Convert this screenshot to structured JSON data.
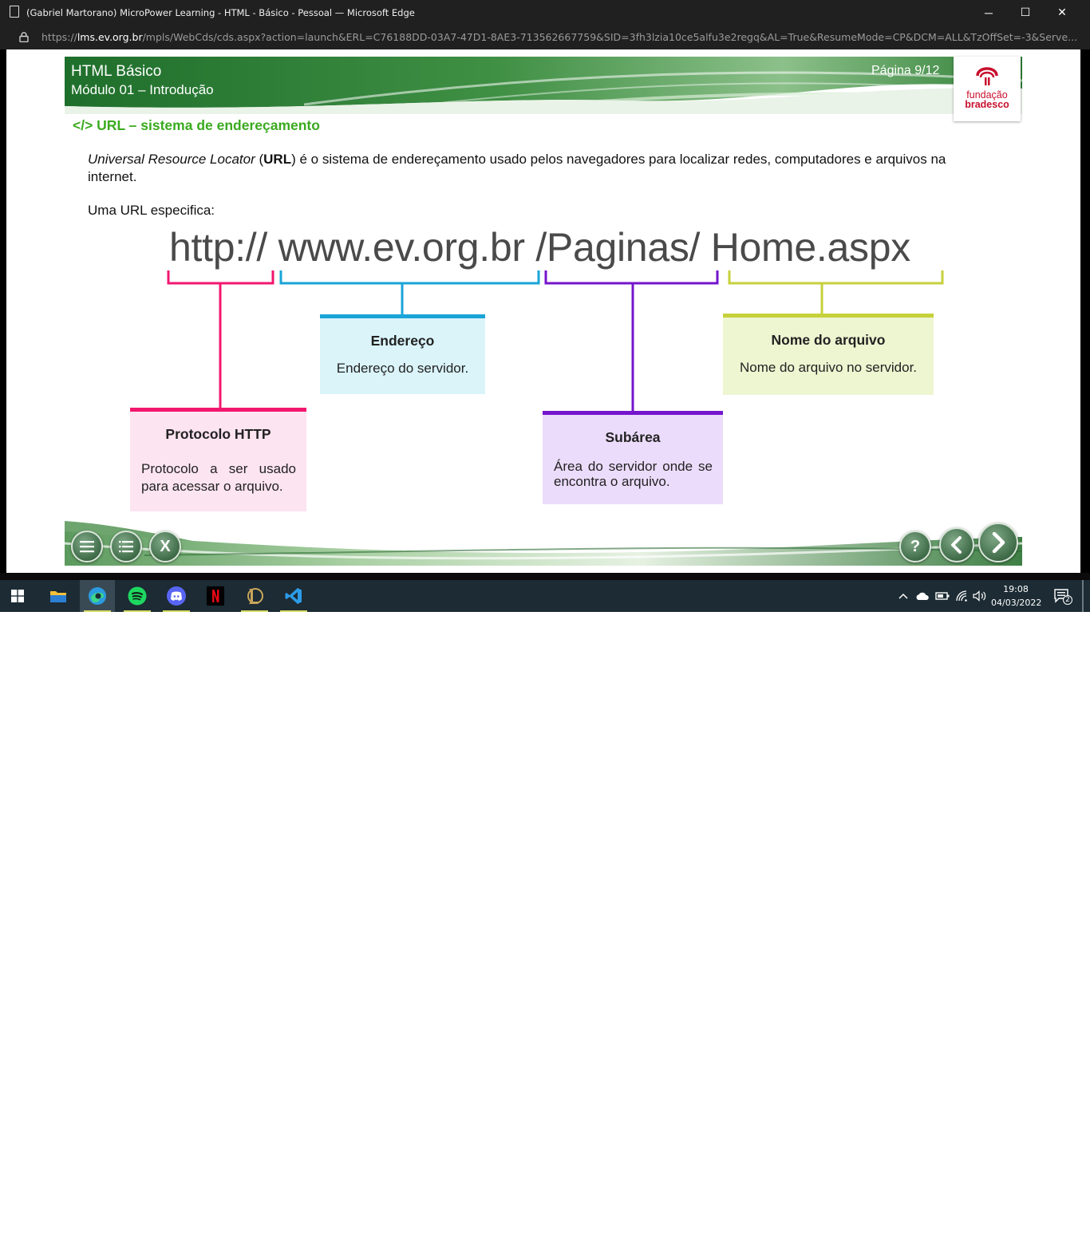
{
  "window": {
    "title": "(Gabriel Martorano) MicroPower Learning - HTML - Básico - Pessoal — Microsoft Edge",
    "controls": {
      "minimize": "─",
      "maximize": "☐",
      "close": "✕"
    }
  },
  "address": {
    "prefix": "https://",
    "host": "lms.ev.org.br",
    "path": "/mpls/WebCds/cds.aspx?action=launch&ERL=C76188DD-03A7-47D1-8AE3-713562667759&SID=3fh3lzia10ce5alfu3e2regq&AL=True&ResumeMode=CP&DCM=ALL&TzOffSet=-3&Serve..."
  },
  "course": {
    "title": "HTML Básico",
    "module": "Módulo 01 – Introdução",
    "page": "Página 9/12",
    "logo": {
      "line1": "fundação",
      "line2": "bradesco"
    },
    "section_title": "</> URL – sistema de endereçamento",
    "para1_italic": "Universal Resource Locator",
    "para1_open": " (",
    "para1_bold": "URL",
    "para1_rest": ") é o sistema de endereçamento usado pelos navegadores para localizar redes, computadores e arquivos na internet.",
    "para2": "Uma URL especifica:",
    "url_parts": {
      "protocol": "http://",
      "address": "www.ev.org.br",
      "subarea": "/Paginas/",
      "file": "Home.aspx"
    },
    "boxes": {
      "http": {
        "title": "Protocolo HTTP",
        "desc": "Protocolo a ser usado para acessar o arquivo.",
        "color": "#f1176f"
      },
      "endereco": {
        "title": "Endereço",
        "desc": "Endereço do servidor.",
        "color": "#1aa4d7"
      },
      "subarea": {
        "title": "Subárea",
        "desc": "Área do servidor onde se encontra o arquivo.",
        "color": "#7515cc"
      },
      "nome": {
        "title": "Nome do arquivo",
        "desc": "Nome do arquivo no servidor.",
        "color": "#c6d13b"
      }
    },
    "footer_buttons": {
      "menu": "menu-icon",
      "list": "list-icon",
      "close": "X",
      "help": "?",
      "prev": "chevron-left-icon",
      "next": "chevron-right-icon"
    }
  },
  "taskbar": {
    "apps": [
      "windows-start",
      "file-explorer",
      "edge",
      "spotify",
      "discord",
      "netflix",
      "league-of-legends",
      "vscode"
    ],
    "time": "19:08",
    "date": "04/03/2022",
    "notifications": "2"
  }
}
